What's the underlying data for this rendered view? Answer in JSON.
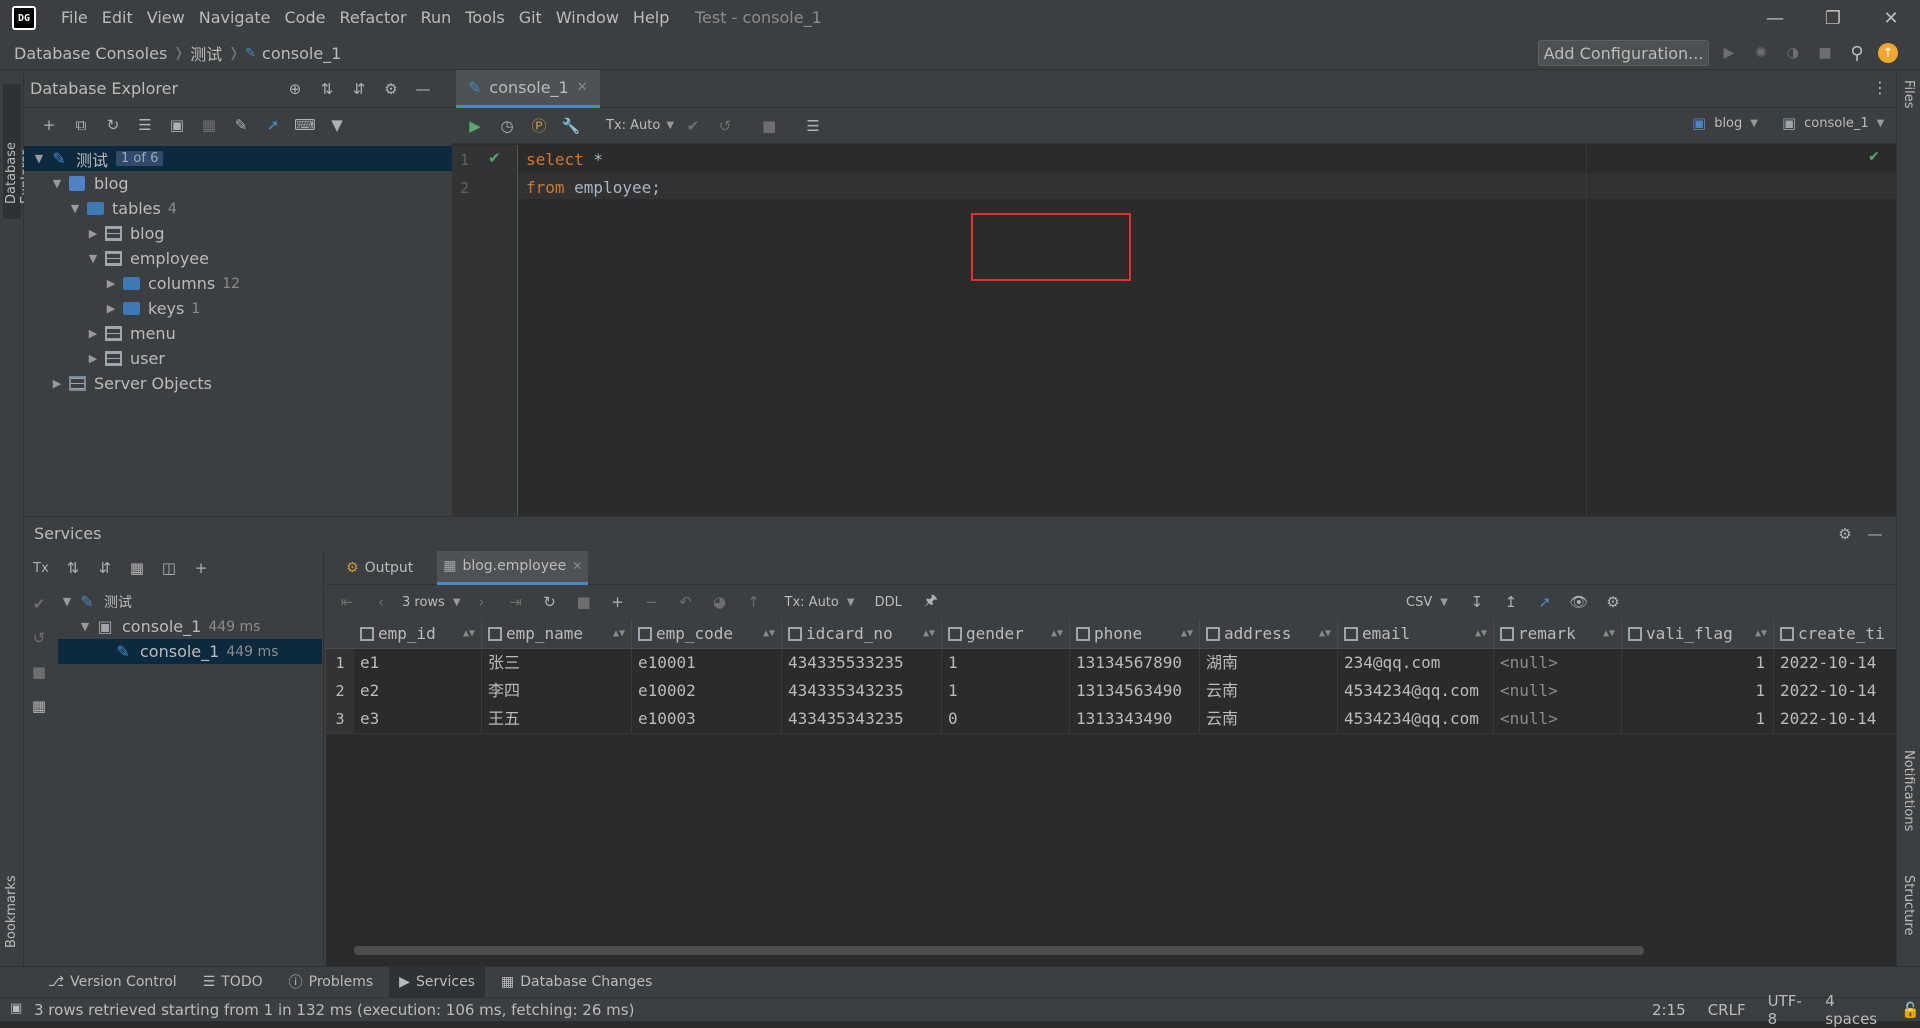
{
  "title_bar": {
    "logo_text": "DG",
    "menu": [
      "File",
      "Edit",
      "View",
      "Navigate",
      "Code",
      "Refactor",
      "Run",
      "Tools",
      "Git",
      "Window",
      "Help"
    ],
    "window_title": "Test - console_1"
  },
  "nav_bar": {
    "breadcrumb": [
      "Database Consoles",
      "测试",
      "console_1"
    ],
    "add_configuration": "Add Configuration..."
  },
  "left_strip": {
    "database_explorer_label": "Database Explorer",
    "bookmarks_label": "Bookmarks"
  },
  "right_strip": {
    "files_label": "Files",
    "notifications_label": "Notifications",
    "structure_label": "Structure"
  },
  "db_explorer": {
    "title": "Database Explorer",
    "root": {
      "label": "测试",
      "badge": "1 of 6"
    },
    "schema": "blog",
    "tables_folder": {
      "label": "tables",
      "count": "4"
    },
    "tables": [
      "blog",
      "employee",
      "menu",
      "user"
    ],
    "employee_children": [
      {
        "label": "columns",
        "count": "12"
      },
      {
        "label": "keys",
        "count": "1"
      }
    ],
    "server_objects": "Server Objects"
  },
  "editor": {
    "tab_label": "console_1",
    "tx_mode": "Tx: Auto",
    "schema_selector": "blog",
    "console_selector": "console_1",
    "lines": [
      {
        "num": "1",
        "keyword": "select",
        "rest": " *"
      },
      {
        "num": "2",
        "keyword": "from",
        "rest": " employee;"
      }
    ]
  },
  "services": {
    "title": "Services",
    "tx_label": "Tx",
    "tree": [
      {
        "label": "测试",
        "time": ""
      },
      {
        "label": "console_1",
        "time": "449 ms"
      },
      {
        "label": "console_1",
        "time": "449 ms"
      }
    ],
    "tabs": [
      "Output",
      "blog.employee"
    ],
    "grid_toolbar": {
      "rows": "3 rows",
      "tx": "Tx: Auto",
      "ddl": "DDL",
      "csv": "CSV"
    },
    "columns": [
      "emp_id",
      "emp_name",
      "emp_code",
      "idcard_no",
      "gender",
      "phone",
      "address",
      "email",
      "remark",
      "vali_flag",
      "create_ti"
    ],
    "rows": [
      {
        "n": "1",
        "cells": [
          "e1",
          "张三",
          "e10001",
          "434335533235",
          "1",
          "13134567890",
          "湖南",
          "234@qq.com",
          "<null>",
          "1",
          "2022-10-14"
        ]
      },
      {
        "n": "2",
        "cells": [
          "e2",
          "李四",
          "e10002",
          "434335343235",
          "1",
          "13134563490",
          "云南",
          "4534234@qq.com",
          "<null>",
          "1",
          "2022-10-14"
        ]
      },
      {
        "n": "3",
        "cells": [
          "e3",
          "王五",
          "e10003",
          "433435343235",
          "0",
          "1313343490",
          "云南",
          "4534234@qq.com",
          "<null>",
          "1",
          "2022-10-14"
        ]
      }
    ]
  },
  "tool_windows": [
    "Version Control",
    "TODO",
    "Problems",
    "Services",
    "Database Changes"
  ],
  "status_bar": {
    "message": "3 rows retrieved starting from 1 in 132 ms (execution: 106 ms, fetching: 26 ms)",
    "position": "2:15",
    "line_sep": "CRLF",
    "encoding": "UTF-8",
    "indent": "4 spaces"
  },
  "colors": {
    "accent": "#4a88c7",
    "keyword": "#cc7832",
    "highlight_box": "#e03131",
    "selection": "#0d293e"
  }
}
